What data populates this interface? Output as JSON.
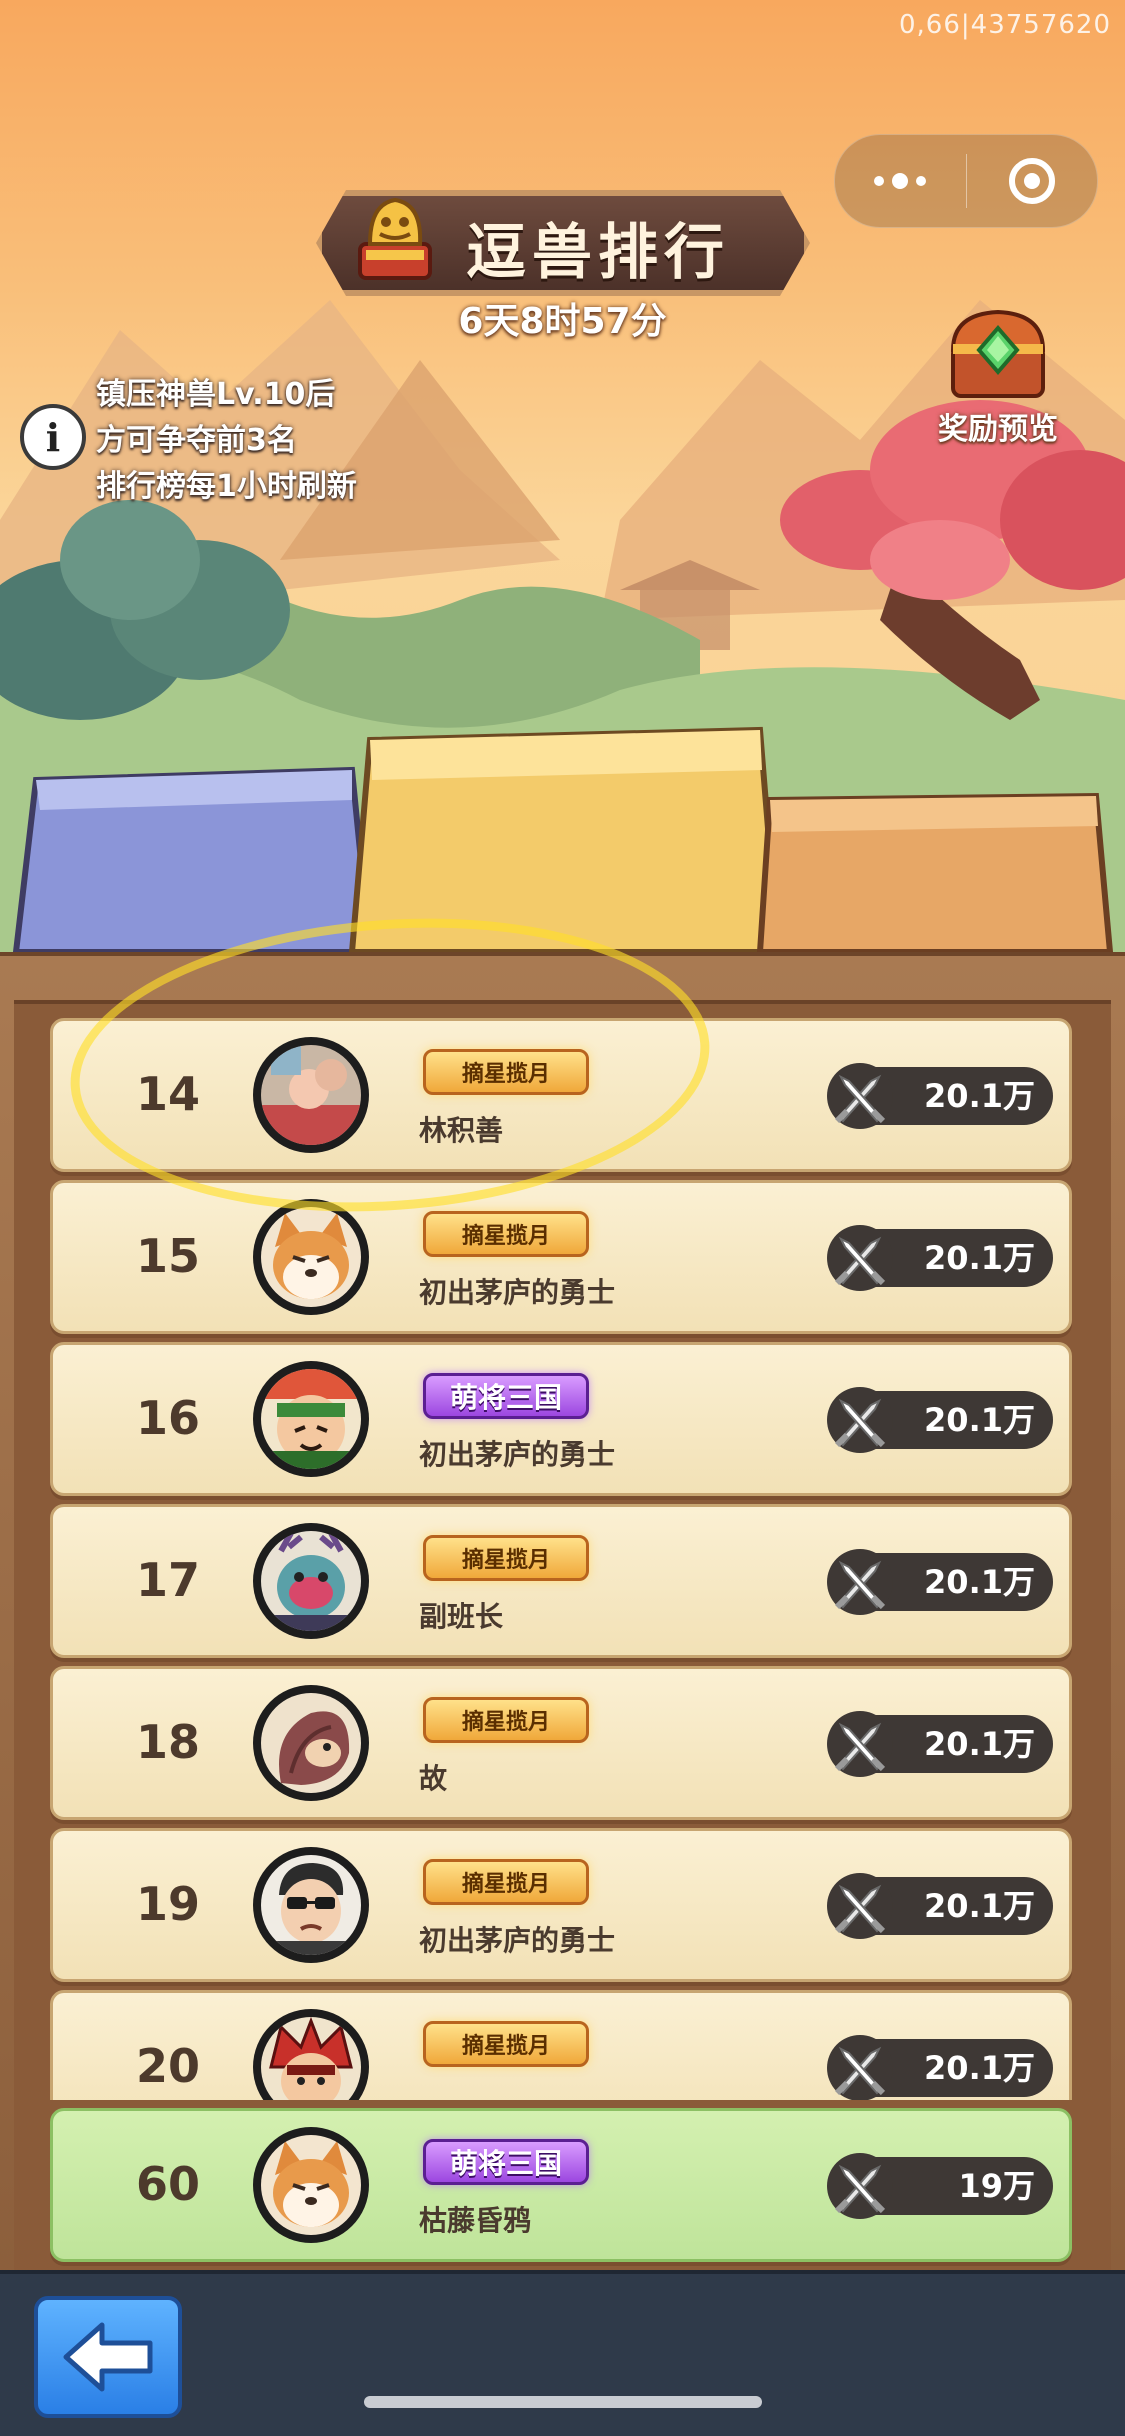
{
  "debug_id": "0,66|43757620",
  "header": {
    "title": "逗兽排行",
    "countdown": "6天8时57分",
    "reward_label": "奖励预览"
  },
  "notes": [
    "镇压神兽Lv.10后",
    "方可争夺前3名",
    "排行榜每1小时刷新"
  ],
  "icons": {
    "info": "info-icon",
    "reward": "treasure-chest-icon",
    "trophy": "golden-beast-trophy-icon",
    "power": "crossed-swords-icon",
    "back": "back-arrow-icon",
    "menu": "more-dots-icon",
    "close": "mini-program-close-icon"
  },
  "rows": [
    {
      "rank": "14",
      "badge": "摘星揽月",
      "badge_style": "gold",
      "name": "林积善",
      "power": "20.1万",
      "avatar": "baby-photo"
    },
    {
      "rank": "15",
      "badge": "摘星揽月",
      "badge_style": "gold",
      "name": "初出茅庐的勇士",
      "power": "20.1万",
      "avatar": "shiba-dog"
    },
    {
      "rank": "16",
      "badge": "萌将三国",
      "badge_style": "purple",
      "name": "初出茅庐的勇士",
      "power": "20.1万",
      "avatar": "warrior-green"
    },
    {
      "rank": "17",
      "badge": "摘星揽月",
      "badge_style": "gold",
      "name": "副班长",
      "power": "20.1万",
      "avatar": "deer-horn-warrior"
    },
    {
      "rank": "18",
      "badge": "摘星揽月",
      "badge_style": "gold",
      "name": "故",
      "power": "20.1万",
      "avatar": "pangolin"
    },
    {
      "rank": "19",
      "badge": "摘星揽月",
      "badge_style": "gold",
      "name": "初出茅庐的勇士",
      "power": "20.1万",
      "avatar": "sunglasses-man"
    },
    {
      "rank": "20",
      "badge": "摘星揽月",
      "badge_style": "gold",
      "name": "",
      "power": "20.1万",
      "avatar": "red-helmet-warrior"
    }
  ],
  "me": {
    "rank": "60",
    "badge": "萌将三国",
    "badge_style": "purple",
    "name": "枯藤昏鸦",
    "power": "19万",
    "avatar": "shiba-dog"
  },
  "colors": {
    "row_bg": "#fbf0d3",
    "me_bg": "#c9eaa5",
    "board": "#8a5b39",
    "highlight": "#ffe028"
  }
}
